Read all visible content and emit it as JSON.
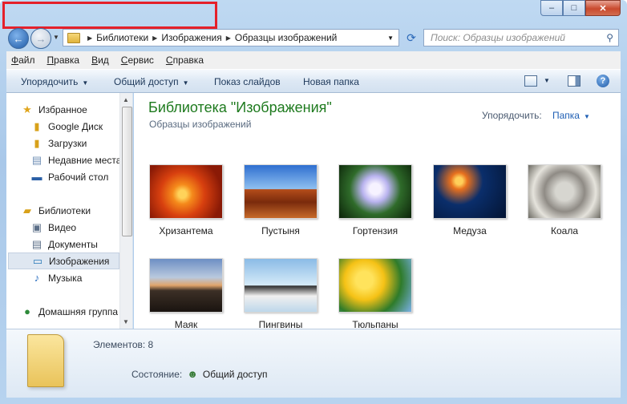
{
  "window": {
    "controls": {
      "minimize": "–",
      "maximize": "□",
      "close": "✕"
    }
  },
  "nav": {
    "back_glyph": "←",
    "forward_glyph": "→",
    "address": [
      "Библиотеки",
      "Изображения",
      "Образцы изображений"
    ],
    "search_placeholder": "Поиск: Образцы изображений"
  },
  "menu": [
    "Файл",
    "Правка",
    "Вид",
    "Сервис",
    "Справка"
  ],
  "toolbar": {
    "organize": "Упорядочить",
    "share": "Общий доступ",
    "slideshow": "Показ слайдов",
    "new_folder": "Новая папка"
  },
  "sidebar": {
    "favorites_label": "Избранное",
    "favorites": [
      "Google Диск",
      "Загрузки",
      "Недавние места",
      "Рабочий стол"
    ],
    "libraries_label": "Библиотеки",
    "libraries": [
      "Видео",
      "Документы",
      "Изображения",
      "Музыка"
    ],
    "selected": "Изображения",
    "homegroup": "Домашняя группа"
  },
  "content": {
    "title": "Библиотека \"Изображения\"",
    "subtitle": "Образцы изображений",
    "arrange_label": "Упорядочить:",
    "arrange_value": "Папка",
    "items": [
      "Хризантема",
      "Пустыня",
      "Гортензия",
      "Медуза",
      "Коала",
      "Маяк",
      "Пингвины",
      "Тюльпаны"
    ]
  },
  "details": {
    "count": "Элементов: 8",
    "state_label": "Состояние:",
    "state_value": "Общий доступ"
  }
}
